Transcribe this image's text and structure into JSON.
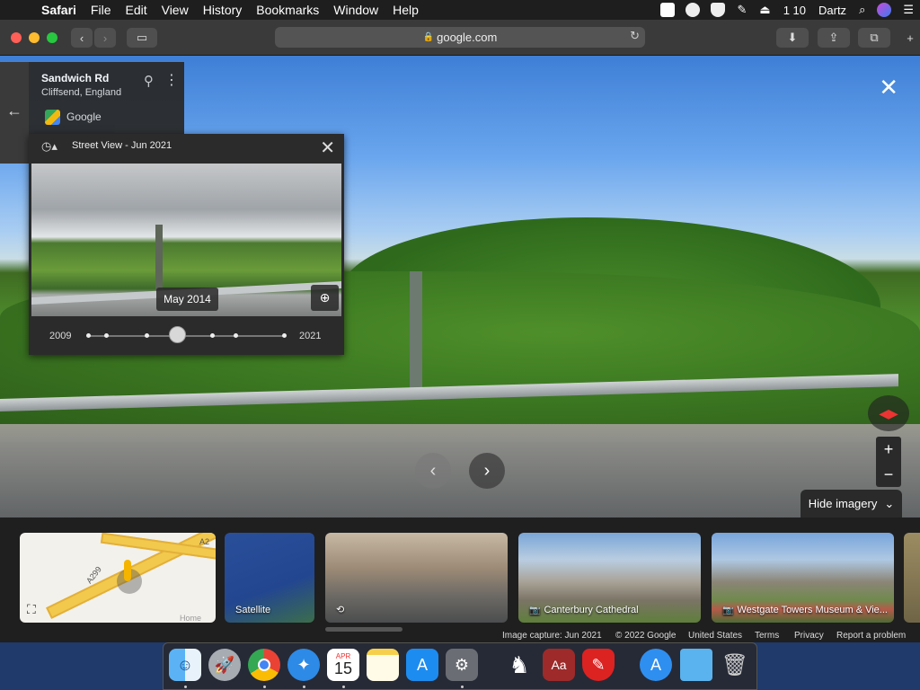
{
  "menubar": {
    "app": "Safari",
    "items": [
      "File",
      "Edit",
      "View",
      "History",
      "Bookmarks",
      "Window",
      "Help"
    ],
    "status_text": "1 10",
    "user": "Dartz"
  },
  "browser": {
    "url": "google.com"
  },
  "address_card": {
    "title": "Sandwich Rd",
    "subtitle": "Cliffsend, England",
    "brand": "Google"
  },
  "time_machine": {
    "title": "Street View - Jun 2021",
    "selected_date": "May 2014",
    "start_year": "2009",
    "end_year": "2021",
    "selected_index": 3,
    "tick_count": 7
  },
  "controls": {
    "hide_imagery": "Hide imagery"
  },
  "cards": {
    "satellite": "Satellite",
    "cathedral": "Canterbury Cathedral",
    "westgate": "Westgate Towers Museum & Vie...",
    "map_road_a": "A299",
    "map_road_b": "A2",
    "map_home": "Home"
  },
  "footer": {
    "capture": "Image capture: Jun 2021",
    "copyright": "© 2022 Google",
    "region": "United States",
    "terms": "Terms",
    "privacy": "Privacy",
    "report": "Report a problem"
  },
  "dock": {
    "calendar_month": "APR",
    "calendar_day": "15"
  },
  "colors": {
    "panel": "#2b2b2b",
    "menubar": "#1e1e1e",
    "close_light": "#ff5f57",
    "min_light": "#febc2e",
    "max_light": "#28c840"
  }
}
